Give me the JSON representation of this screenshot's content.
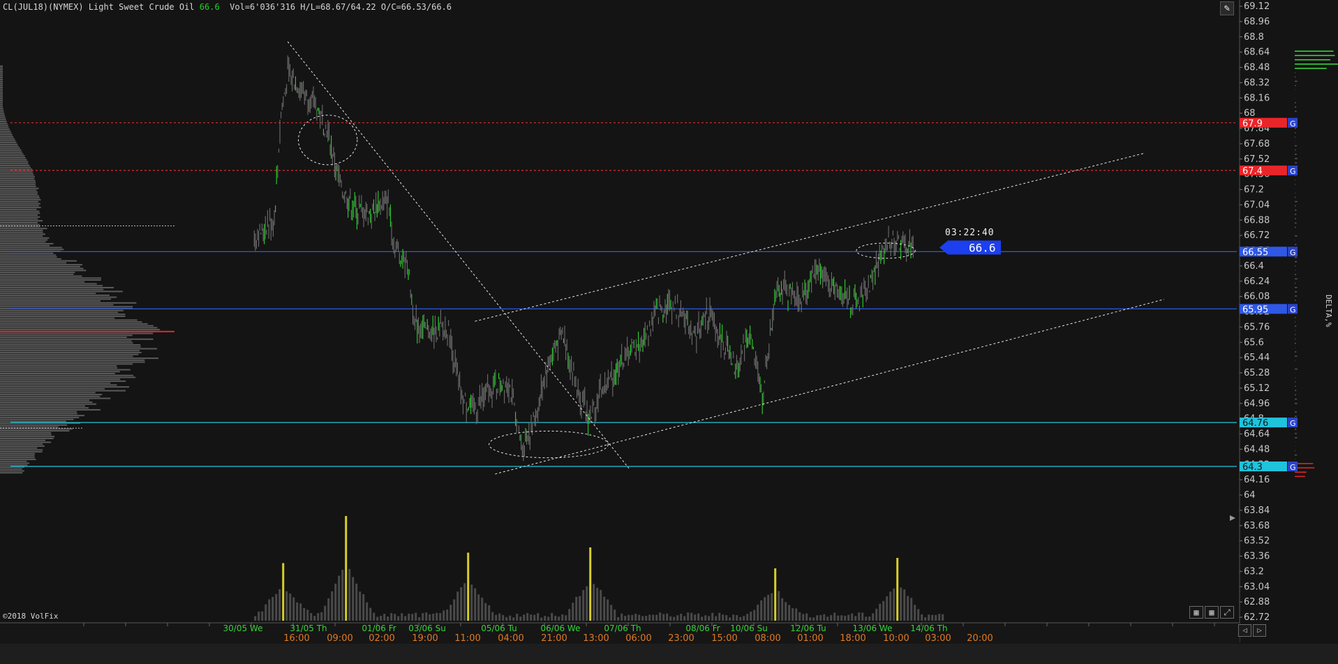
{
  "header": {
    "symbol": "CL(JUL18)(NYMEX) Light Sweet Crude Oil",
    "last": "66.6",
    "stats": "Vol=6'036'316 H/L=68.67/64.22 O/C=66.53/66.6"
  },
  "copyright": "©2018 VolFix",
  "delta_label": "DELTA,%",
  "timer": "03:22:40",
  "tools": {
    "pen_icon": "✎",
    "grid_icon": "▦",
    "multi_icon": "▦",
    "expand_icon": "⤢",
    "prev_icon": "◁",
    "next_icon": "▷"
  },
  "colors": {
    "bg": "#141414",
    "up": "#22c322",
    "down": "#7a7a7a",
    "red_level": "#e8262a",
    "blue_level": "#2f58e6",
    "cyan_level": "#1fc3dc",
    "volume_peak": "#d8cf2a"
  },
  "chart_data": {
    "type": "candlestick",
    "ylim": [
      62.64,
      69.18
    ],
    "y_ticks": [
      "69.12",
      "68.96",
      "68.8",
      "68.64",
      "68.48",
      "68.32",
      "68.16",
      "68",
      "67.84",
      "67.68",
      "67.52",
      "67.36",
      "67.2",
      "67.04",
      "66.88",
      "66.72",
      "66.56",
      "66.4",
      "66.24",
      "66.08",
      "65.92",
      "65.76",
      "65.6",
      "65.44",
      "65.28",
      "65.12",
      "64.96",
      "64.8",
      "64.64",
      "64.48",
      "64.32",
      "64.16",
      "64",
      "63.84",
      "63.68",
      "63.52",
      "63.36",
      "63.2",
      "63.04",
      "62.88",
      "62.72"
    ],
    "date_labels": [
      "30/05 We",
      "31/05 Th",
      "01/06 Fr",
      "03/06 Su",
      "05/06 Tu",
      "06/06 We",
      "07/06 Th",
      "08/06 Fr",
      "10/06 Su",
      "12/06 Tu",
      "13/06 We",
      "14/06 Th"
    ],
    "time_labels": [
      "16:00",
      "09:00",
      "02:00",
      "19:00",
      "11:00",
      "04:00",
      "21:00",
      "13:00",
      "06:00",
      "23:00",
      "15:00",
      "08:00",
      "01:00",
      "18:00",
      "10:00",
      "03:00",
      "20:00"
    ],
    "levels": [
      {
        "price": 67.9,
        "label": "67.9",
        "color": "#e8262a",
        "style": "dashed",
        "tag": "G"
      },
      {
        "price": 67.4,
        "label": "67.4",
        "color": "#e8262a",
        "style": "dashed",
        "tag": "G"
      },
      {
        "price": 66.55,
        "label": "66.55",
        "color": "#2f58e6",
        "style": "solid",
        "tag": "G"
      },
      {
        "price": 65.95,
        "label": "65.95",
        "color": "#2f58e6",
        "style": "solid",
        "tag": "G"
      },
      {
        "price": 64.76,
        "label": "64.76",
        "color": "#1fc3dc",
        "style": "solid",
        "tag": "G"
      },
      {
        "price": 64.3,
        "label": "64.3",
        "color": "#1fc3dc",
        "style": "solid",
        "tag": "G"
      }
    ],
    "last_price": {
      "value": 66.6,
      "label": "66.6"
    },
    "trendlines": [
      {
        "from": [
          0.215,
          68.75
        ],
        "to": [
          0.47,
          64.28
        ]
      },
      {
        "from": [
          0.355,
          65.82
        ],
        "to": [
          0.855,
          67.58
        ]
      },
      {
        "from": [
          0.37,
          64.22
        ],
        "to": [
          0.87,
          66.05
        ]
      }
    ],
    "ellipses": [
      {
        "t": 0.245,
        "p": 67.72,
        "rt": 0.022,
        "rp": 0.26
      },
      {
        "t": 0.41,
        "p": 64.53,
        "rt": 0.0445,
        "rp": 0.14
      },
      {
        "t": 0.662,
        "p": 66.56,
        "rt": 0.022,
        "rp": 0.08
      }
    ],
    "price_path": [
      [
        0.19,
        66.7
      ],
      [
        0.205,
        66.9
      ],
      [
        0.21,
        68.0
      ],
      [
        0.215,
        68.4
      ],
      [
        0.225,
        68.25
      ],
      [
        0.235,
        68.1
      ],
      [
        0.245,
        67.8
      ],
      [
        0.255,
        67.2
      ],
      [
        0.265,
        67.0
      ],
      [
        0.275,
        66.95
      ],
      [
        0.29,
        67.1
      ],
      [
        0.295,
        66.6
      ],
      [
        0.305,
        66.4
      ],
      [
        0.31,
        65.8
      ],
      [
        0.32,
        65.7
      ],
      [
        0.335,
        65.75
      ],
      [
        0.345,
        65.0
      ],
      [
        0.355,
        64.9
      ],
      [
        0.365,
        65.1
      ],
      [
        0.38,
        65.2
      ],
      [
        0.39,
        64.5
      ],
      [
        0.4,
        64.8
      ],
      [
        0.41,
        65.4
      ],
      [
        0.42,
        65.7
      ],
      [
        0.43,
        65.2
      ],
      [
        0.44,
        64.8
      ],
      [
        0.45,
        65.1
      ],
      [
        0.46,
        65.3
      ],
      [
        0.47,
        65.5
      ],
      [
        0.48,
        65.6
      ],
      [
        0.49,
        65.9
      ],
      [
        0.5,
        66.0
      ],
      [
        0.51,
        65.9
      ],
      [
        0.52,
        65.7
      ],
      [
        0.53,
        65.9
      ],
      [
        0.54,
        65.6
      ],
      [
        0.55,
        65.3
      ],
      [
        0.56,
        65.7
      ],
      [
        0.57,
        65.0
      ],
      [
        0.575,
        65.6
      ],
      [
        0.58,
        66.2
      ],
      [
        0.59,
        66.1
      ],
      [
        0.6,
        66.05
      ],
      [
        0.61,
        66.4
      ],
      [
        0.62,
        66.2
      ],
      [
        0.63,
        66.1
      ],
      [
        0.64,
        66.0
      ],
      [
        0.65,
        66.2
      ],
      [
        0.66,
        66.55
      ],
      [
        0.665,
        66.7
      ],
      [
        0.675,
        66.6
      ],
      [
        0.683,
        66.6
      ]
    ],
    "volume_peaks": [
      {
        "t": 0.211,
        "v": 0.55
      },
      {
        "t": 0.258,
        "v": 1.0
      },
      {
        "t": 0.349,
        "v": 0.65
      },
      {
        "t": 0.441,
        "v": 0.7
      },
      {
        "t": 0.578,
        "v": 0.5
      },
      {
        "t": 0.67,
        "v": 0.6
      }
    ]
  }
}
